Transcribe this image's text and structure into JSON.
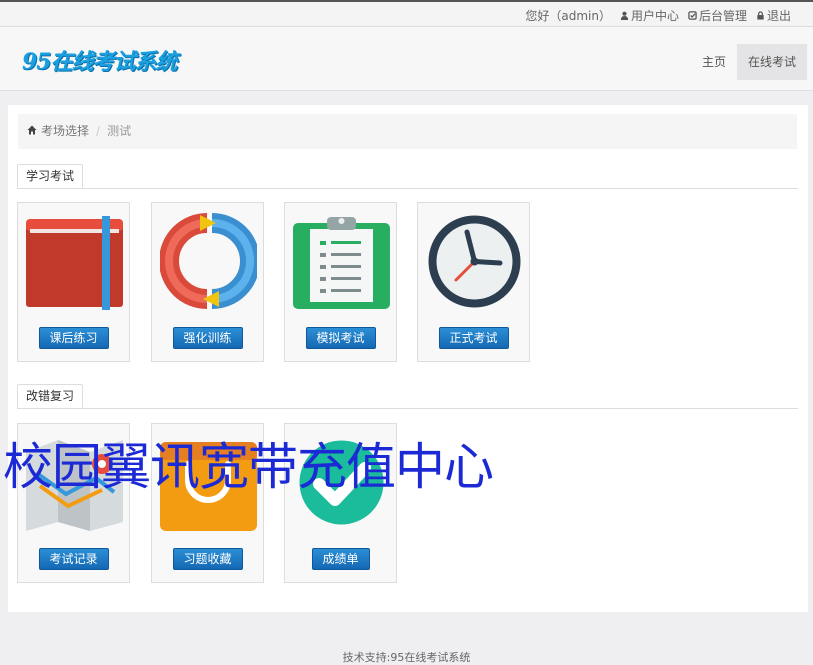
{
  "topbar": {
    "greeting": "您好（admin）",
    "user_center": "用户中心",
    "admin": "后台管理",
    "logout": "退出"
  },
  "header": {
    "logo": "95在线考试系统",
    "nav": [
      {
        "label": "主页"
      },
      {
        "label": "在线考试",
        "active": true
      }
    ]
  },
  "breadcrumb": {
    "home": "考场选择",
    "current": "测试"
  },
  "sections": [
    {
      "title": "学习考试",
      "items": [
        {
          "label": "课后练习",
          "icon": "book-icon"
        },
        {
          "label": "强化训练",
          "icon": "refresh-arrows-icon"
        },
        {
          "label": "模拟考试",
          "icon": "clipboard-icon"
        },
        {
          "label": "正式考试",
          "icon": "clock-icon"
        }
      ]
    },
    {
      "title": "改错复习",
      "items": [
        {
          "label": "考试记录",
          "icon": "map-icon"
        },
        {
          "label": "习题收藏",
          "icon": "shopping-bag-icon"
        },
        {
          "label": "成绩单",
          "icon": "checkmark-icon"
        }
      ]
    }
  ],
  "overlay_text": "校园翼讯宽带充值中心",
  "footer": "技术支持:95在线考试系统",
  "colors": {
    "accent_button": "#1a74c2",
    "overlay_text": "#1c2ad6",
    "logo": "#1aa0e0"
  }
}
